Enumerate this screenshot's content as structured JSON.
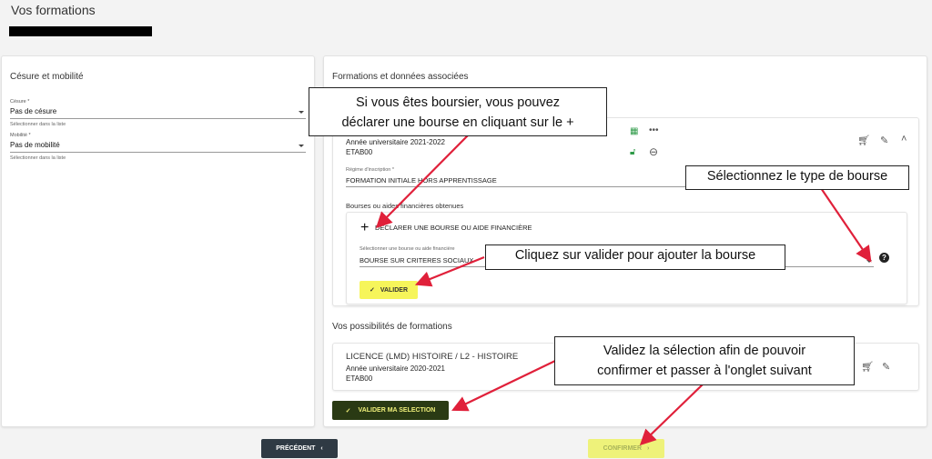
{
  "page": {
    "title": "Vos formations"
  },
  "left": {
    "title": "Césure et mobilité",
    "cesure": {
      "label": "Césure *",
      "value": "Pas de césure",
      "helper": "Sélectionner dans la liste"
    },
    "mobilite": {
      "label": "Mobilité *",
      "value": "Pas de mobilité",
      "helper": "Sélectionner dans la liste"
    }
  },
  "right": {
    "title": "Formations et données associées",
    "formation": {
      "year": "Année universitaire 2021-2022",
      "etab": "ETAB00",
      "regime_label": "Régime d'inscription *",
      "regime_value": "FORMATION INITIALE HORS APPRENTISSAGE",
      "bourses_title": "Bourses ou aides financières obtenues",
      "declare_label": "DÉCLARER UNE BOURSE OU AIDE FINANCIÈRE",
      "select_label": "Sélectionner une bourse ou aide financière",
      "select_value": "BOURSE SUR CRITERES SOCIAUX",
      "valider_label": "VALIDER"
    },
    "possibilites_title": "Vos possibilités de formations",
    "possibilite": {
      "title": "LICENCE (LMD) HISTOIRE / L2 - HISTOIRE",
      "year": "Année universitaire 2020-2021",
      "etab": "ETAB00"
    },
    "valider_selection_label": "VALIDER MA SELECTION"
  },
  "nav": {
    "precedent_label": "PRÉCÉDENT",
    "confirmer_label": "CONFIRMER"
  },
  "callouts": {
    "c1_line1": "Si vous êtes boursier, vous pouvez",
    "c1_line2": "déclarer une bourse en cliquant sur le +",
    "c2": "Sélectionnez le type de bourse",
    "c3": "Cliquez sur valider pour ajouter la bourse",
    "c4_line1": "Validez la sélection afin de pouvoir",
    "c4_line2": "confirmer et passer à l'onglet suivant"
  },
  "icons": {
    "calendar": "calendar-icon",
    "more": "more-horiz-icon",
    "lock": "lock-open-icon",
    "remove": "remove-circle-icon",
    "cart_remove": "cart-remove-icon",
    "edit": "pencil-icon",
    "collapse": "chevron-up-icon",
    "plus": "plus-icon",
    "help": "help-icon",
    "check": "check-icon",
    "cart_add": "cart-add-icon",
    "chevron_left": "chevron-left-icon",
    "chevron_right": "chevron-right-icon"
  },
  "colors": {
    "accent_yellow": "#f6f55a",
    "dark_button": "#2a3a14",
    "nav_button": "#2f3a44",
    "arrow": "#e0203a",
    "icon_green": "#2e9a48"
  }
}
